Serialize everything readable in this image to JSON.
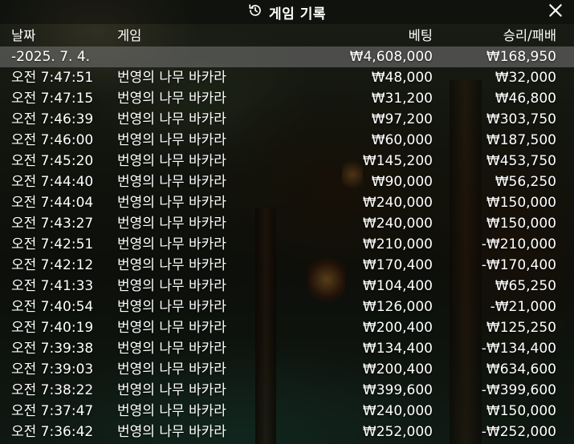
{
  "window": {
    "title": "게임 기록",
    "title_icon": "history-icon",
    "close_icon": "close-icon"
  },
  "columns": {
    "time": "날짜",
    "game": "게임",
    "bet": "베팅",
    "result": "승리/패배"
  },
  "date_group": {
    "label": "-2025. 7. 4.",
    "bet_total": "₩4,608,000",
    "result_total": "₩168,950"
  },
  "rows": [
    {
      "time": "오전 7:47:51",
      "game": "번영의 나무 바카라",
      "bet": "₩48,000",
      "result": "₩32,000"
    },
    {
      "time": "오전 7:47:15",
      "game": "번영의 나무 바카라",
      "bet": "₩31,200",
      "result": "₩46,800"
    },
    {
      "time": "오전 7:46:39",
      "game": "번영의 나무 바카라",
      "bet": "₩97,200",
      "result": "₩303,750"
    },
    {
      "time": "오전 7:46:00",
      "game": "번영의 나무 바카라",
      "bet": "₩60,000",
      "result": "₩187,500"
    },
    {
      "time": "오전 7:45:20",
      "game": "번영의 나무 바카라",
      "bet": "₩145,200",
      "result": "₩453,750"
    },
    {
      "time": "오전 7:44:40",
      "game": "번영의 나무 바카라",
      "bet": "₩90,000",
      "result": "₩56,250"
    },
    {
      "time": "오전 7:44:04",
      "game": "번영의 나무 바카라",
      "bet": "₩240,000",
      "result": "₩150,000"
    },
    {
      "time": "오전 7:43:27",
      "game": "번영의 나무 바카라",
      "bet": "₩240,000",
      "result": "₩150,000"
    },
    {
      "time": "오전 7:42:51",
      "game": "번영의 나무 바카라",
      "bet": "₩210,000",
      "result": "-₩210,000"
    },
    {
      "time": "오전 7:42:12",
      "game": "번영의 나무 바카라",
      "bet": "₩170,400",
      "result": "-₩170,400"
    },
    {
      "time": "오전 7:41:33",
      "game": "번영의 나무 바카라",
      "bet": "₩104,400",
      "result": "₩65,250"
    },
    {
      "time": "오전 7:40:54",
      "game": "번영의 나무 바카라",
      "bet": "₩126,000",
      "result": "-₩21,000"
    },
    {
      "time": "오전 7:40:19",
      "game": "번영의 나무 바카라",
      "bet": "₩200,400",
      "result": "₩125,250"
    },
    {
      "time": "오전 7:39:38",
      "game": "번영의 나무 바카라",
      "bet": "₩134,400",
      "result": "-₩134,400"
    },
    {
      "time": "오전 7:39:03",
      "game": "번영의 나무 바카라",
      "bet": "₩200,400",
      "result": "₩634,600"
    },
    {
      "time": "오전 7:38:22",
      "game": "번영의 나무 바카라",
      "bet": "₩399,600",
      "result": "-₩399,600"
    },
    {
      "time": "오전 7:37:47",
      "game": "번영의 나무 바카라",
      "bet": "₩240,000",
      "result": "₩150,000"
    },
    {
      "time": "오전 7:36:42",
      "game": "번영의 나무 바카라",
      "bet": "₩252,000",
      "result": "-₩252,000"
    }
  ]
}
